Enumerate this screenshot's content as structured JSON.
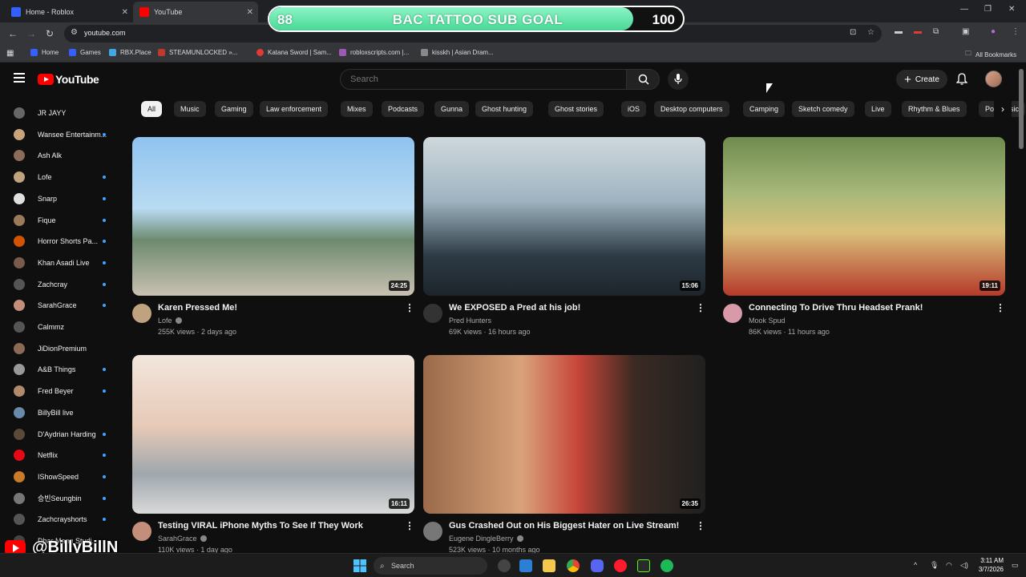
{
  "browser": {
    "tabs": [
      {
        "title": "Home - Roblox",
        "color": "#335fff"
      },
      {
        "title": "YouTube",
        "color": "#ff0000"
      }
    ],
    "url": "youtube.com",
    "bookmarks": [
      {
        "label": "Home",
        "color": "#335fff"
      },
      {
        "label": "Games",
        "color": "#335fff"
      },
      {
        "label": "RBX.Place",
        "color": "#3fa7e8"
      },
      {
        "label": "STEAMUNLOCKED »...",
        "color": "#c0392b"
      },
      {
        "label": "Katana Sword | Sam...",
        "color": "#e53935"
      },
      {
        "label": "robloxscripts.com |...",
        "color": "#9b59b6"
      },
      {
        "label": "kisskh | Asian Dram...",
        "color": "#888888"
      }
    ],
    "all_bookmarks": "All Bookmarks"
  },
  "goal": {
    "title": "BAC TATTOO SUB GOAL",
    "current": "88",
    "target": "100",
    "progress": 0.88
  },
  "youtube": {
    "logo_text": "YouTube",
    "search_placeholder": "Search",
    "create_label": "Create",
    "chips": [
      "All",
      "Music",
      "Gaming",
      "Law enforcement",
      "Mixes",
      "Podcasts",
      "Gunna",
      "Ghost hunting",
      "Ghost stories",
      "iOS",
      "Desktop computers",
      "Camping",
      "Sketch comedy",
      "Live",
      "Rhythm & Blues",
      "Pop Music"
    ],
    "subscriptions": [
      {
        "name": "JR JAYY",
        "live": false,
        "color": "#666"
      },
      {
        "name": "Wansee Entertainm...",
        "live": true,
        "color": "#c9a37a"
      },
      {
        "name": "Ash Alk",
        "live": false,
        "color": "#8b6b5a"
      },
      {
        "name": "Lofe",
        "live": true,
        "color": "#bfa27e"
      },
      {
        "name": "Snarp",
        "live": true,
        "color": "#e0e0e0"
      },
      {
        "name": "Fique",
        "live": true,
        "color": "#9a7a5a"
      },
      {
        "name": "Horror Shorts Pa...",
        "live": true,
        "color": "#d35400"
      },
      {
        "name": "Khan Asadi Live",
        "live": true,
        "color": "#7a5a4a"
      },
      {
        "name": "Zachcray",
        "live": true,
        "color": "#555"
      },
      {
        "name": "SarahGrace",
        "live": true,
        "color": "#c48f7a"
      },
      {
        "name": "Calmmz",
        "live": false,
        "color": "#555"
      },
      {
        "name": "JiDionPremium",
        "live": false,
        "color": "#8a6a55"
      },
      {
        "name": "A&B Things",
        "live": true,
        "color": "#999"
      },
      {
        "name": "Fred Beyer",
        "live": true,
        "color": "#b08a6a"
      },
      {
        "name": "BillyBill live",
        "live": false,
        "color": "#6a8aaa"
      },
      {
        "name": "D'Aydrian Harding",
        "live": true,
        "color": "#5a4a3a"
      },
      {
        "name": "Netflix",
        "live": true,
        "color": "#e50914"
      },
      {
        "name": "IShowSpeed",
        "live": true,
        "color": "#c97b2a"
      },
      {
        "name": "승빈Seungbin",
        "live": true,
        "color": "#777"
      },
      {
        "name": "Zachcrayshorts",
        "live": true,
        "color": "#555"
      },
      {
        "name": "Dhar Mann Studi...",
        "live": false,
        "color": "#444"
      }
    ],
    "videos": [
      {
        "title": "Karen Pressed Me!",
        "channel": "Lofe",
        "verified": true,
        "meta": "255K views · 2 days ago",
        "duration": "24:25",
        "thumb": "linear-gradient(180deg,#8fc3ef 0%,#b9dbf3 45%,#6d8a6f 65%,#c9c1b2 100%)",
        "avatar": "#bfa27e"
      },
      {
        "title": "We EXPOSED a Pred at his job!",
        "channel": "Pred Hunters",
        "verified": false,
        "meta": "69K views · 16 hours ago",
        "duration": "15:06",
        "thumb": "linear-gradient(180deg,#cfd8dc 0%,#9fb4c1 40%,#2d3a44 75%,#1d252b 100%)",
        "avatar": "#333"
      },
      {
        "title": "Connecting To Drive Thru Headset Prank!",
        "channel": "Mook Spud",
        "verified": false,
        "meta": "86K views · 11 hours ago",
        "duration": "19:11",
        "thumb": "linear-gradient(180deg,#6f8b4f 0%,#a7b87a 35%,#d9c07a 60%,#b53a2a 100%)",
        "avatar": "#d89aa8"
      },
      {
        "title": "Testing VIRAL iPhone Myths To See If They Work",
        "channel": "SarahGrace",
        "verified": true,
        "meta": "110K views · 1 day ago",
        "duration": "16:11",
        "thumb": "linear-gradient(180deg,#f2e6dc 0%,#e7c9b7 45%,#9fa7ad 75%,#d9d9d9 100%)",
        "avatar": "#c48f7a"
      },
      {
        "title": "Gus Crashed Out on His Biggest Hater on Live Stream!",
        "channel": "Eugene DingleBerry",
        "verified": true,
        "meta": "523K views · 10 months ago",
        "duration": "26:35",
        "thumb": "linear-gradient(90deg,#9a6a4a 0%,#d8a27a 35%,#c7453a 55%,#3a2a22 75%,#202020 100%)",
        "avatar": "#777"
      }
    ]
  },
  "overlay": {
    "handle": "@BillyBillN"
  },
  "taskbar": {
    "search": "Search",
    "time": "3:11 AM",
    "date": "3/7/2026"
  }
}
